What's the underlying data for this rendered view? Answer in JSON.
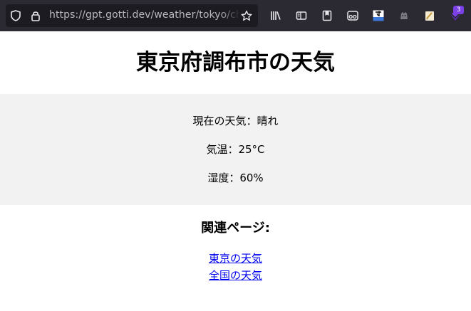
{
  "browser": {
    "url": "https://gpt.gotti.dev/weather/tokyo/chofu",
    "icons": [
      "shield-icon",
      "lock-icon",
      "bookmark-star-icon",
      "library-icon",
      "sidebar-icon",
      "save-to-pocket-icon",
      "extension-glasses-icon",
      "extension-translate-icon",
      "extension-cat-icon",
      "extension-notepad-icon",
      "extension-purple-icon"
    ],
    "extension_badge": "3"
  },
  "page": {
    "title": "東京府調布市の天気",
    "weather": {
      "condition": "現在の天気：晴れ",
      "temperature": "気温：25°C",
      "humidity": "湿度：60%"
    },
    "related": {
      "heading": "関連ページ:",
      "links": [
        "東京の天気",
        "全国の天気"
      ]
    }
  }
}
